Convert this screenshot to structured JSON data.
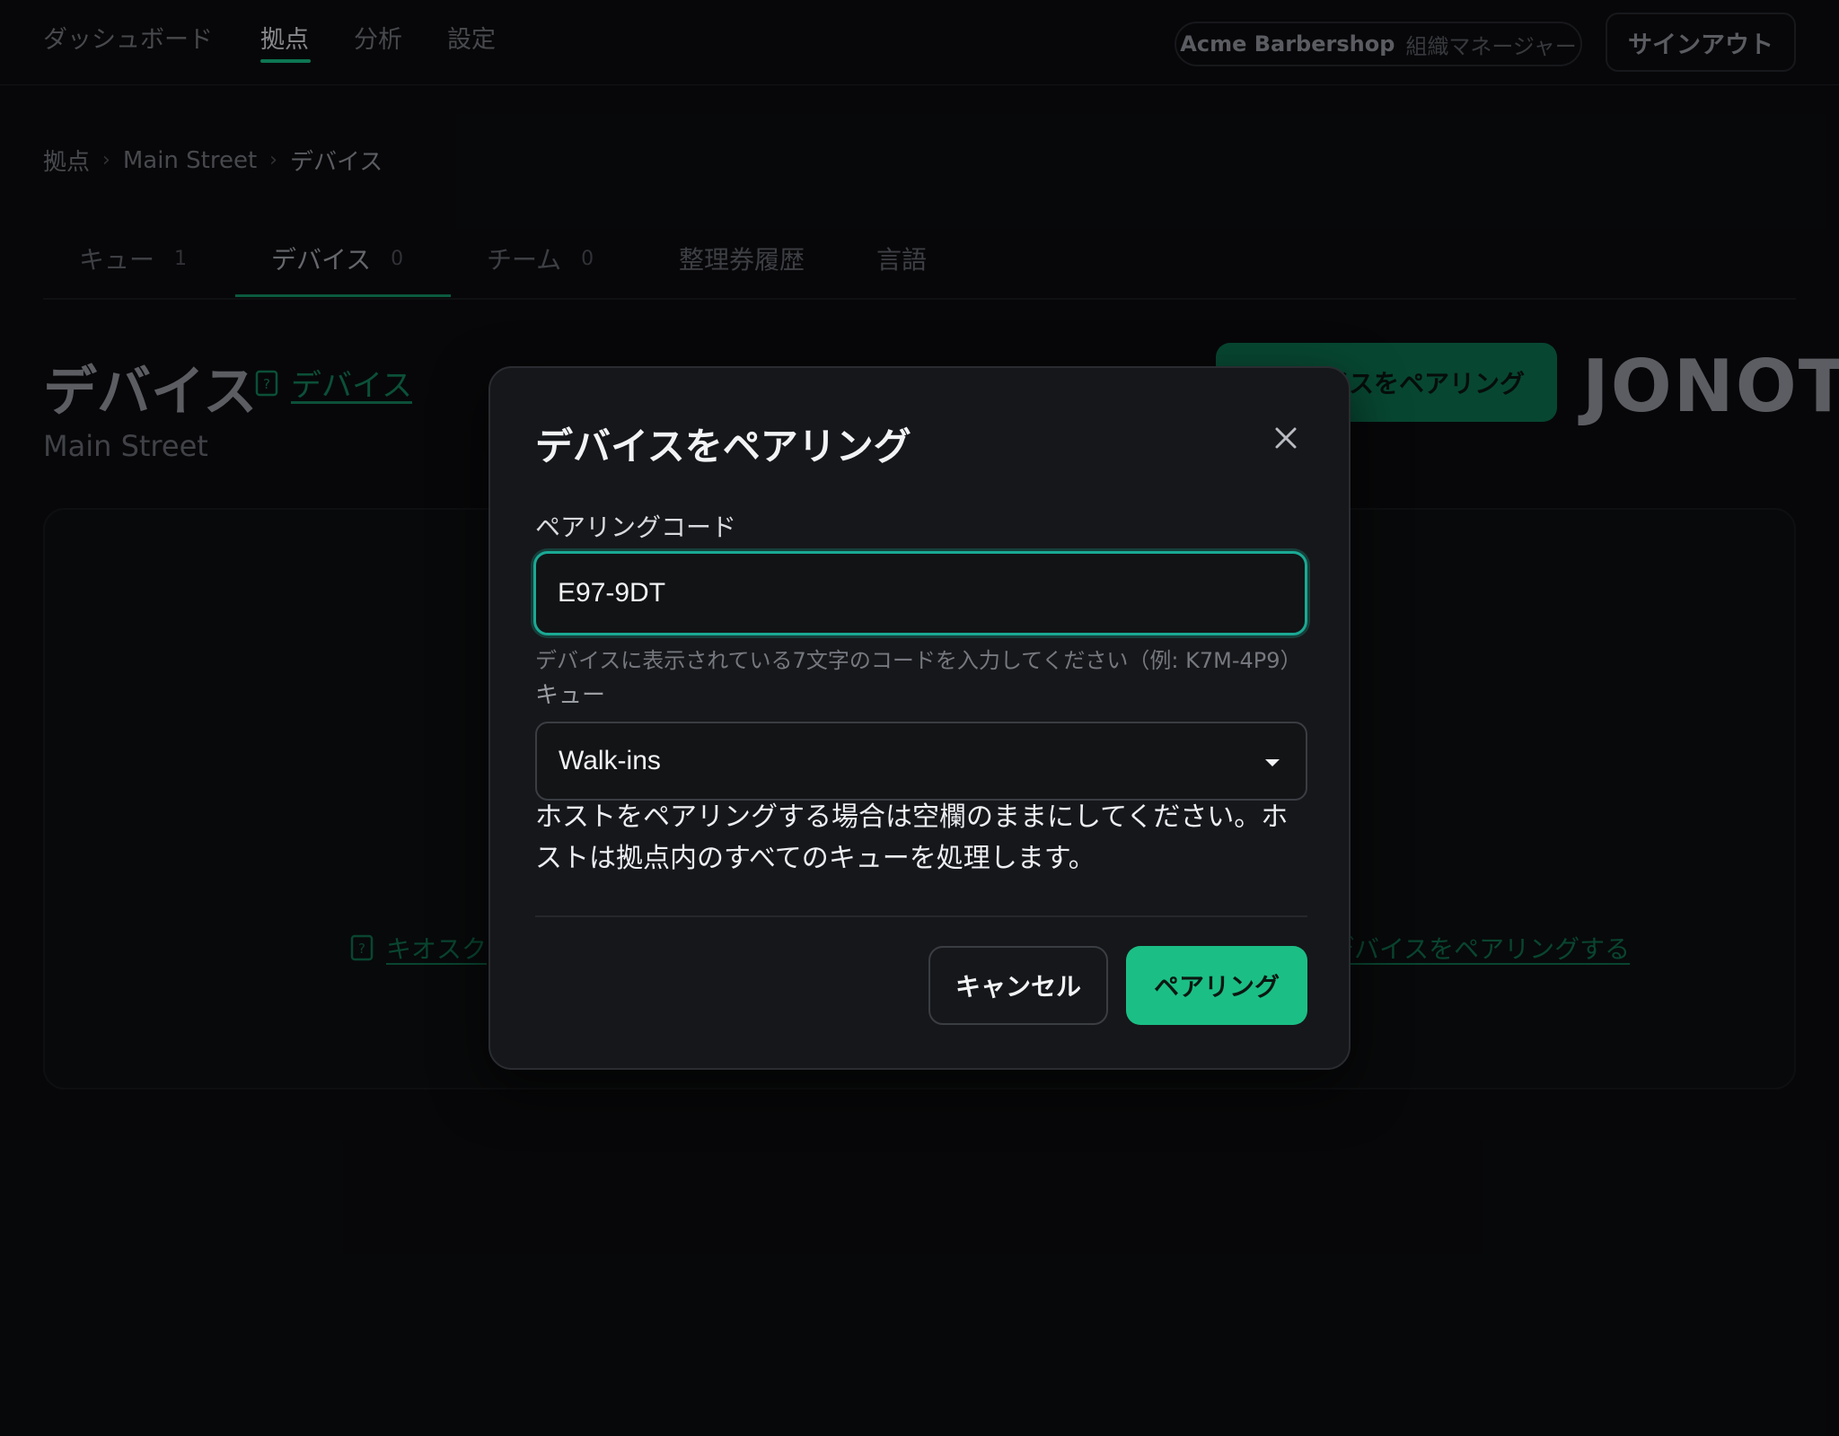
{
  "nav": {
    "items": [
      {
        "label": "ダッシュボード"
      },
      {
        "label": "拠点"
      },
      {
        "label": "分析"
      },
      {
        "label": "設定"
      }
    ],
    "org_name": "Acme Barbershop",
    "org_role": "組織マネージャー",
    "signout_label": "サインアウト"
  },
  "breadcrumb": {
    "items": [
      "拠点",
      "Main Street",
      "デバイス"
    ],
    "separator": "›"
  },
  "tabs": [
    {
      "label": "キュー",
      "count": "1"
    },
    {
      "label": "デバイス",
      "count": "0"
    },
    {
      "label": "チーム",
      "count": "0"
    },
    {
      "label": "整理券履歴",
      "count": ""
    },
    {
      "label": "言語",
      "count": ""
    }
  ],
  "header": {
    "title": "デバイス",
    "doc_link": "デバイス",
    "subtitle": "Main Street",
    "pair_button": "デバイスをペアリング",
    "brand": "JONOT"
  },
  "empty_state": {
    "kiosk_link": "キオスク",
    "pair_link": "デバイスをペアリングする"
  },
  "modal": {
    "title": "デバイスをペアリング",
    "code_label": "ペアリングコード",
    "code_value": "E97-9DT",
    "code_hint": "デバイスに表示されている7文字のコードを入力してください（例: K7M-4P9）",
    "queue_label": "キュー",
    "queue_value": "Walk-ins",
    "host_note": "ホストをペアリングする場合は空欄のままにしてください。ホストは拠点内のすべてのキューを処理します。",
    "cancel_label": "キャンセル",
    "pair_label": "ペアリング"
  },
  "colors": {
    "accent": "#1bbf85",
    "focus_ring": "#1aa994",
    "background": "#0b0c0e",
    "modal_bg": "#16171a"
  }
}
